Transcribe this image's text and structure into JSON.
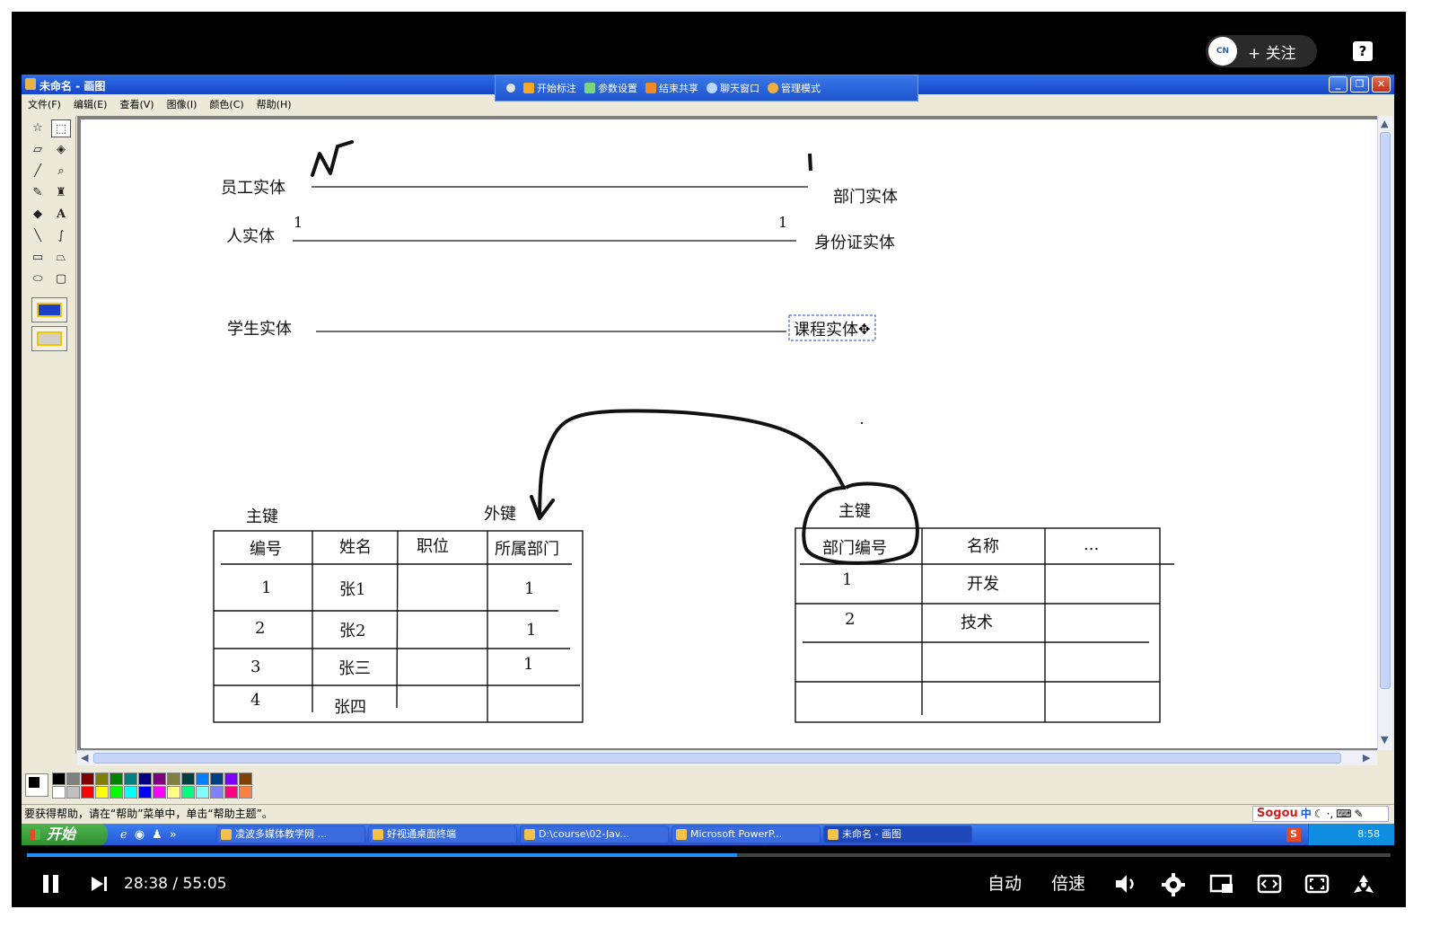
{
  "player": {
    "follow_label": "+ 关注",
    "help_label": "?",
    "time_current": "28:38",
    "time_total": "55:05",
    "time_sep": " / ",
    "progress_fraction": 0.521,
    "auto_label": "自动",
    "speed_label": "倍速"
  },
  "window": {
    "title": "未命名 - 画图",
    "share_toolbar": [
      "开始标注",
      "参数设置",
      "结束共享",
      "聊天窗口",
      "管理模式"
    ],
    "menu": [
      "文件(F)",
      "编辑(E)",
      "查看(V)",
      "图像(I)",
      "颜色(C)",
      "帮助(H)"
    ],
    "status_text": "要获得帮助，请在“帮助”菜单中，单击“帮助主题”。",
    "ime": {
      "logo": "Sogou",
      "mode": "中"
    }
  },
  "taskbar": {
    "start_label": "开始",
    "tasks": [
      "凌波多媒体教学网 ...",
      "好视通桌面终端",
      "D:\\course\\02-Jav...",
      "Microsoft PowerP...",
      "未命名 - 画图"
    ],
    "tray_brand": "S",
    "clock": "8:58"
  },
  "canvas": {
    "relations": [
      {
        "left": "员工实体",
        "right": "部门实体",
        "left_card": "N",
        "right_card": "1"
      },
      {
        "left": "人实体",
        "right": "身份证实体",
        "left_card": "1",
        "right_card": "1"
      },
      {
        "left": "学生实体",
        "right": "课程实体"
      }
    ],
    "labels": {
      "primary_key_left": "主键",
      "foreign_key": "外键",
      "primary_key_right": "主键"
    },
    "employee_table": {
      "headers": [
        "编号",
        "姓名",
        "职位",
        "所属部门"
      ],
      "rows": [
        [
          "1",
          "张1",
          "",
          "1"
        ],
        [
          "2",
          "张2",
          "",
          "1"
        ],
        [
          "3",
          "张三",
          "",
          "1"
        ],
        [
          "4",
          "张四",
          "",
          ""
        ]
      ]
    },
    "department_table": {
      "headers": [
        "部门编号",
        "名称",
        "..."
      ],
      "rows": [
        [
          "1",
          "开发",
          ""
        ],
        [
          "2",
          "技术",
          ""
        ],
        [
          "",
          "",
          ""
        ],
        [
          "",
          "",
          ""
        ]
      ]
    }
  },
  "palette_colors": [
    "#000000",
    "#808080",
    "#800000",
    "#808000",
    "#008000",
    "#008080",
    "#000080",
    "#800080",
    "#808040",
    "#004040",
    "#0080ff",
    "#004080",
    "#8000ff",
    "#804000",
    "#ffffff",
    "#c0c0c0",
    "#ff0000",
    "#ffff00",
    "#00ff00",
    "#00ffff",
    "#0000ff",
    "#ff00ff",
    "#ffff80",
    "#00ff80",
    "#80ffff",
    "#8080ff",
    "#ff0080",
    "#ff8040"
  ],
  "accent_colors": {
    "xp_blue": "#1546c7",
    "progress": "#1e90ff",
    "start_green": "#2f8f2f"
  }
}
